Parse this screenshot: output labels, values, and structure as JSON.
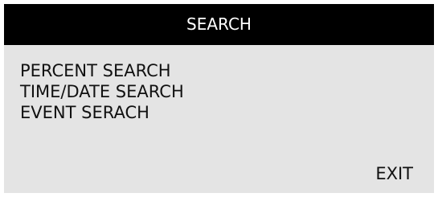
{
  "window": {
    "title": "SEARCH"
  },
  "menu": {
    "items": [
      {
        "label": "PERCENT SEARCH"
      },
      {
        "label": "TIME/DATE SEARCH"
      },
      {
        "label": "EVENT SERACH"
      }
    ]
  },
  "footer": {
    "exit_label": "EXIT"
  },
  "colors": {
    "title_bar_bg": "#000000",
    "title_text": "#ffffff",
    "panel_bg": "#e4e4e4",
    "text": "#111111"
  }
}
